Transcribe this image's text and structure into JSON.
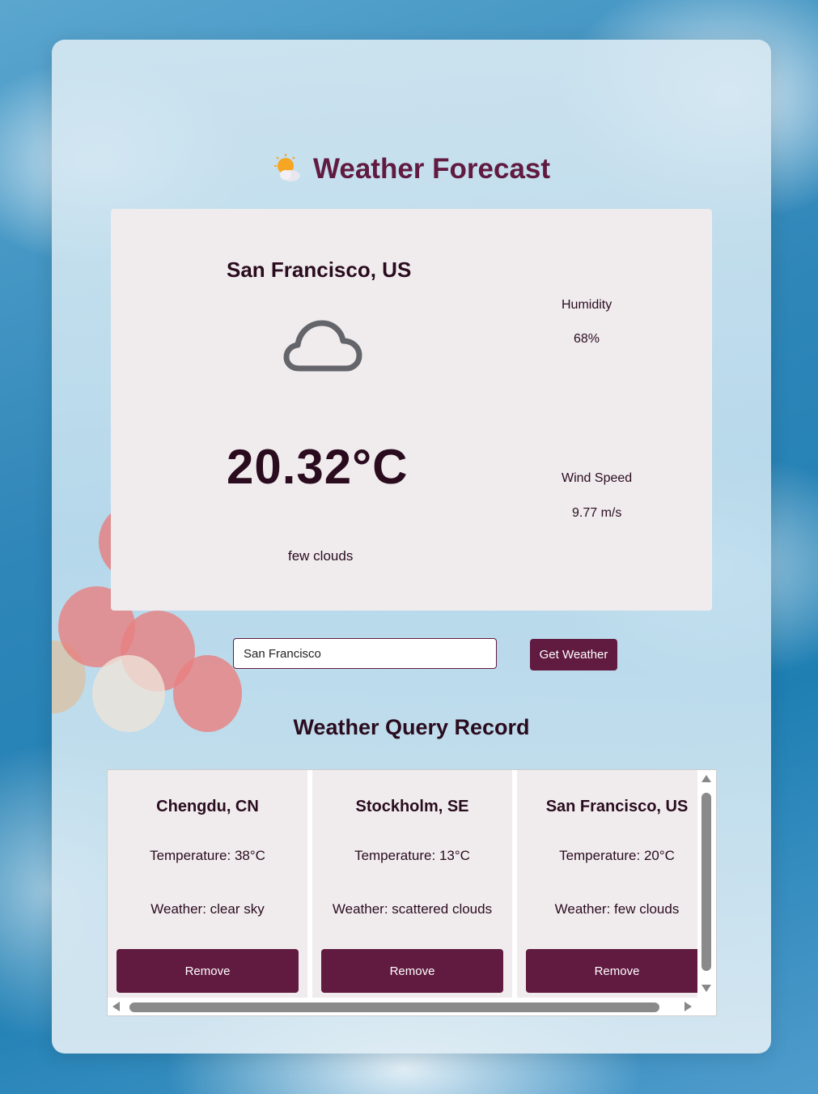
{
  "app": {
    "title": "Weather Forecast"
  },
  "current": {
    "city": "San Francisco, US",
    "temperature": "20.32°C",
    "description": "few clouds",
    "humidity_label": "Humidity",
    "humidity_value": "68%",
    "wind_label": "Wind Speed",
    "wind_value": "9.77 m/s",
    "icon": "cloud-icon"
  },
  "search": {
    "value": "San Francisco",
    "button_label": "Get Weather"
  },
  "records": {
    "title": "Weather Query Record",
    "items": [
      {
        "city": "Chengdu, CN",
        "temperature": "Temperature: 38°C",
        "weather": "Weather: clear sky",
        "remove_label": "Remove"
      },
      {
        "city": "Stockholm, SE",
        "temperature": "Temperature: 13°C",
        "weather": "Weather: scattered clouds",
        "remove_label": "Remove"
      },
      {
        "city": "San Francisco, US",
        "temperature": "Temperature: 20°C",
        "weather": "Weather: few clouds",
        "remove_label": "Remove"
      }
    ]
  },
  "colors": {
    "accent": "#611a40",
    "card_bg": "#f0ecee",
    "text_dark": "#2a0c1e"
  }
}
